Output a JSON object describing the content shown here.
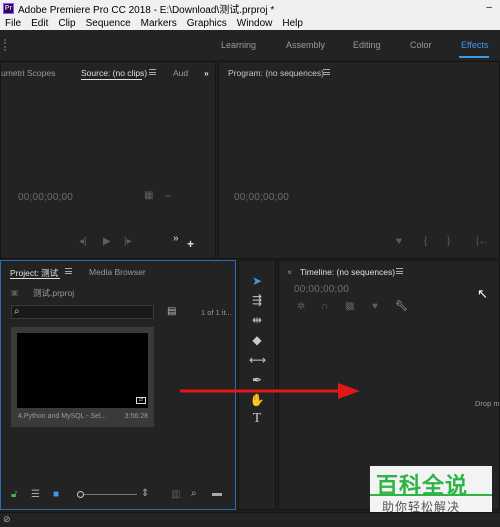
{
  "window": {
    "app_icon": "Pr",
    "title": "Adobe Premiere Pro CC 2018 - E:\\Download\\测试.prproj *",
    "minimize_glyph": "–"
  },
  "menubar": {
    "items": [
      "File",
      "Edit",
      "Clip",
      "Sequence",
      "Markers",
      "Graphics",
      "Window",
      "Help"
    ]
  },
  "workspaces": {
    "tabs": [
      "Learning",
      "Assembly",
      "Editing",
      "Color",
      "Effects"
    ],
    "active": "Effects",
    "accent_color": "#3d9ae8"
  },
  "source_panel": {
    "tabs": [
      "umetri Scopes",
      "Source: (no clips)",
      "Aud"
    ],
    "more": "»",
    "timecode": "00;00;00;00"
  },
  "program_panel": {
    "title": "Program: (no sequences)",
    "timecode": "00;00;00;00"
  },
  "project_panel": {
    "tabs": [
      "Project: 测试",
      "Media Browser"
    ],
    "project_file": "测试.prproj",
    "search_placeholder": "",
    "item_count": "1 of 1 it...",
    "clip": {
      "name": "4.Python and MySQL - Sel...",
      "duration": "3:56:28"
    },
    "border_color": "#2d6dad"
  },
  "timeline_panel": {
    "title": "Timeline: (no sequences)",
    "timecode": "00;00;00;00",
    "drop_hint": "Drop m"
  },
  "annotation_arrow": {
    "color": "#e01818"
  },
  "watermark": {
    "title": "百科全说",
    "subtitle": "助你轻松解决",
    "color": "#2db446"
  },
  "icons": {
    "search": "search-icon",
    "selection": "selection-tool-icon",
    "track_select": "track-select-tool-icon",
    "ripple": "ripple-edit-tool-icon",
    "razor": "razor-tool-icon",
    "slip": "slip-tool-icon",
    "pen": "pen-tool-icon",
    "hand": "hand-tool-icon",
    "type": "type-tool-icon"
  }
}
